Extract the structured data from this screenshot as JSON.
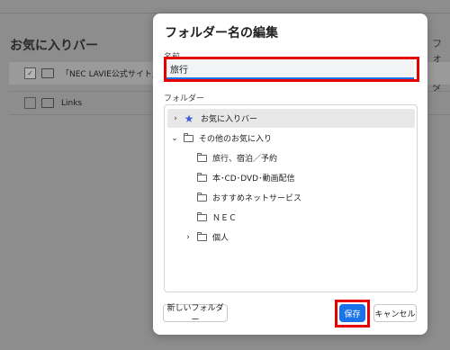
{
  "background": {
    "title": "お気に入りバー",
    "topright_button": "フォルダ",
    "rows": [
      {
        "label": "「NEC LAVIE公式サイト」",
        "checked": true
      },
      {
        "label": "Links",
        "checked": false
      }
    ]
  },
  "dialog": {
    "title": "フォルダー名の編集",
    "name_label": "名前",
    "name_value": "旅行",
    "folder_label": "フォルダー",
    "tree": [
      {
        "label": "お気に入りバー",
        "chevron": "›",
        "icon": "star-icon",
        "selected": true
      },
      {
        "label": "その他のお気に入り",
        "chevron": "⌄",
        "icon": "folder-icon",
        "selected": false
      },
      {
        "label": "旅行、宿泊／予約",
        "chevron": "",
        "icon": "folder-icon",
        "selected": false
      },
      {
        "label": "本･CD･DVD･動画配信",
        "chevron": "",
        "icon": "folder-icon",
        "selected": false
      },
      {
        "label": "おすすめネットサービス",
        "chevron": "",
        "icon": "folder-icon",
        "selected": false
      },
      {
        "label": "ＮＥＣ",
        "chevron": "",
        "icon": "folder-icon",
        "selected": false
      },
      {
        "label": "個人",
        "chevron": "›",
        "icon": "folder-icon",
        "selected": false
      }
    ],
    "buttons": {
      "new_folder": "新しいフォルダー",
      "save": "保存",
      "cancel": "キャンセル"
    }
  },
  "colors": {
    "accent": "#1a73e8",
    "highlight": "#e60000",
    "star": "#3b5fd9"
  }
}
